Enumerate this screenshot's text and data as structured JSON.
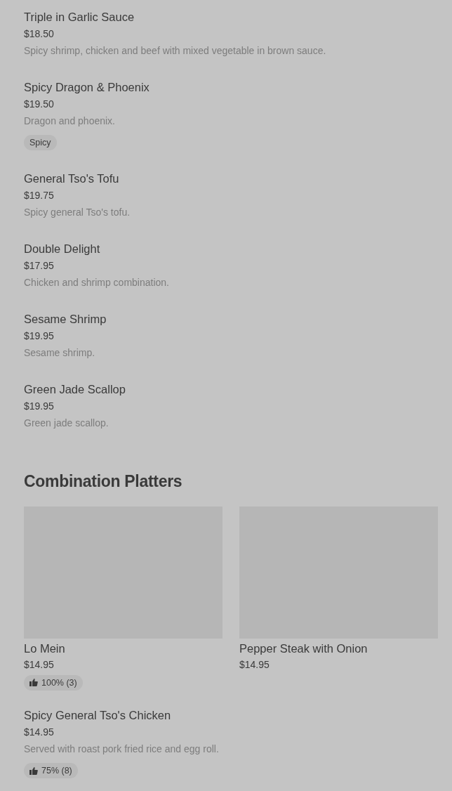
{
  "items": [
    {
      "name": "Triple in Garlic Sauce",
      "price": "$18.50",
      "description": "Spicy shrimp, chicken and beef with mixed vegetable in brown sauce."
    },
    {
      "name": "Spicy Dragon & Phoenix",
      "price": "$19.50",
      "description": "Dragon and phoenix.",
      "tags": [
        "Spicy"
      ]
    },
    {
      "name": "General Tso's Tofu",
      "price": "$19.75",
      "description": "Spicy general Tso's tofu."
    },
    {
      "name": "Double Delight",
      "price": "$17.95",
      "description": "Chicken and shrimp combination."
    },
    {
      "name": "Sesame Shrimp",
      "price": "$19.95",
      "description": "Sesame shrimp."
    },
    {
      "name": "Green Jade Scallop",
      "price": "$19.95",
      "description": "Green jade scallop."
    }
  ],
  "section": {
    "title": "Combination Platters",
    "cards": [
      {
        "name": "Lo Mein",
        "price": "$14.95",
        "rating": "100% (3)"
      },
      {
        "name": "Pepper Steak with Onion",
        "price": "$14.95"
      }
    ],
    "items": [
      {
        "name": "Spicy General Tso's Chicken",
        "price": "$14.95",
        "description": "Served with roast pork fried rice and egg roll.",
        "rating": "75% (8)"
      }
    ]
  }
}
